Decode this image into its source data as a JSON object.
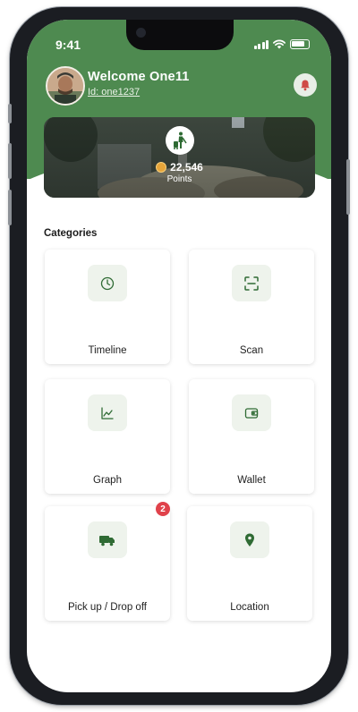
{
  "status": {
    "time": "9:41"
  },
  "user": {
    "welcome": "Welcome One11",
    "id_text": "Id: one1237"
  },
  "banner": {
    "points": "22,546",
    "points_label": "Points"
  },
  "categories": {
    "title": "Categories",
    "items": [
      {
        "label": "Timeline",
        "icon": "clock-icon"
      },
      {
        "label": "Scan",
        "icon": "scan-icon"
      },
      {
        "label": "Graph",
        "icon": "chart-icon"
      },
      {
        "label": "Wallet",
        "icon": "wallet-icon"
      },
      {
        "label": "Pick up / Drop off",
        "icon": "truck-icon",
        "badge": "2"
      },
      {
        "label": "Location",
        "icon": "location-pin-icon"
      }
    ]
  },
  "colors": {
    "brand_green": "#4e8a50",
    "icon_green": "#2f6b34",
    "badge_red": "#e0424b"
  }
}
